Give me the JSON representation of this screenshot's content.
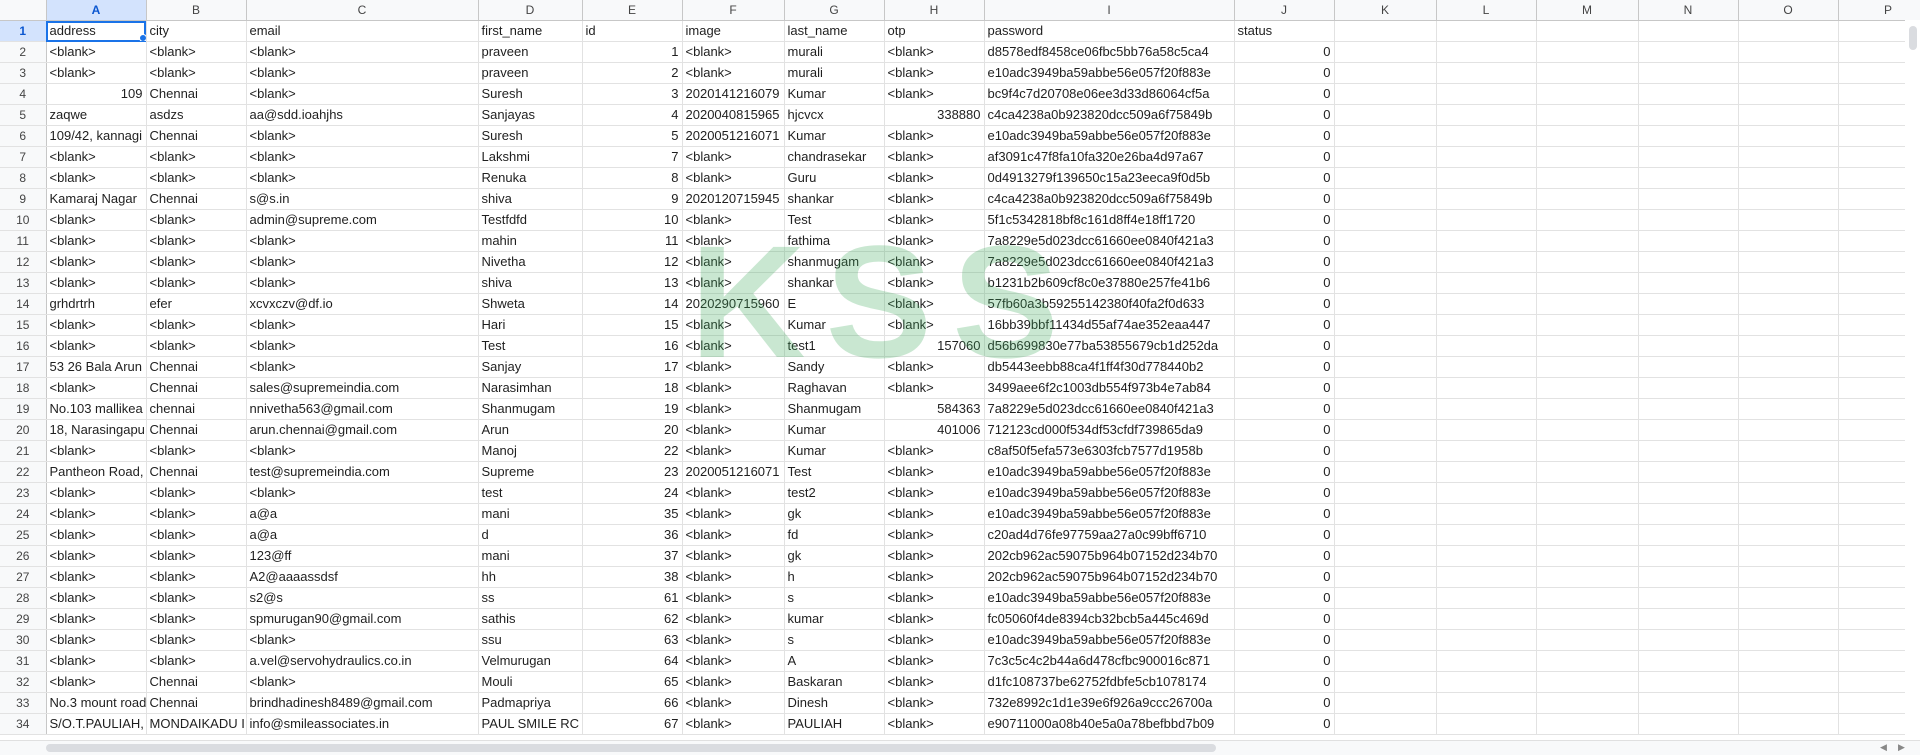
{
  "columns": [
    "A",
    "B",
    "C",
    "D",
    "E",
    "F",
    "G",
    "H",
    "I",
    "J",
    "K",
    "L",
    "M",
    "N",
    "O",
    "P"
  ],
  "header": [
    "address",
    "city",
    "email",
    "first_name",
    "id",
    "image",
    "last_name",
    "otp",
    "password",
    "status",
    "",
    "",
    "",
    "",
    "",
    ""
  ],
  "rows": [
    {
      "n": "2",
      "c": [
        "<blank>",
        "<blank>",
        "<blank>",
        "praveen",
        "1",
        "<blank>",
        "murali",
        "<blank>",
        "d8578edf8458ce06fbc5bb76a58c5ca4",
        "0"
      ]
    },
    {
      "n": "3",
      "c": [
        "<blank>",
        "<blank>",
        "<blank>",
        "praveen",
        "2",
        "<blank>",
        "murali",
        "<blank>",
        "e10adc3949ba59abbe56e057f20f883e",
        "0"
      ]
    },
    {
      "n": "4",
      "c": [
        "109",
        "Chennai",
        "<blank>",
        "Suresh",
        "3",
        "2020141216079",
        "Kumar",
        "<blank>",
        "bc9f4c7d20708e06ee3d33d86064cf5a",
        "0"
      ]
    },
    {
      "n": "5",
      "c": [
        "zaqwe",
        "asdzs",
        "aa@sdd.ioahjhs",
        "Sanjayas",
        "4",
        "2020040815965",
        "hjcvcx",
        "338880",
        "c4ca4238a0b923820dcc509a6f75849b",
        "0"
      ]
    },
    {
      "n": "6",
      "c": [
        "109/42, kannagi",
        "Chennai",
        "<blank>",
        "Suresh",
        "5",
        "2020051216071",
        "Kumar",
        "<blank>",
        "e10adc3949ba59abbe56e057f20f883e",
        "0"
      ]
    },
    {
      "n": "7",
      "c": [
        "<blank>",
        "<blank>",
        "<blank>",
        "Lakshmi",
        "7",
        "<blank>",
        "chandrasekar",
        "<blank>",
        "af3091c47f8fa10fa320e26ba4d97a67",
        "0"
      ]
    },
    {
      "n": "8",
      "c": [
        "<blank>",
        "<blank>",
        "<blank>",
        "Renuka",
        "8",
        "<blank>",
        "Guru",
        "<blank>",
        "0d4913279f139650c15a23eeca9f0d5b",
        "0"
      ]
    },
    {
      "n": "9",
      "c": [
        "Kamaraj Nagar",
        "Chennai",
        "s@s.in",
        "shiva",
        "9",
        "2020120715945",
        "shankar",
        "<blank>",
        "c4ca4238a0b923820dcc509a6f75849b",
        "0"
      ]
    },
    {
      "n": "10",
      "c": [
        "<blank>",
        "<blank>",
        "admin@supreme.com",
        "Testfdfd",
        "10",
        "<blank>",
        "Test",
        "<blank>",
        "5f1c5342818bf8c161d8ff4e18ff1720",
        "0"
      ]
    },
    {
      "n": "11",
      "c": [
        "<blank>",
        "<blank>",
        "<blank>",
        "mahin",
        "11",
        "<blank>",
        "fathima",
        "<blank>",
        "7a8229e5d023dcc61660ee0840f421a3",
        "0"
      ]
    },
    {
      "n": "12",
      "c": [
        "<blank>",
        "<blank>",
        "<blank>",
        "Nivetha",
        "12",
        "<blank>",
        "shanmugam",
        "<blank>",
        "7a8229e5d023dcc61660ee0840f421a3",
        "0"
      ]
    },
    {
      "n": "13",
      "c": [
        "<blank>",
        "<blank>",
        "<blank>",
        "shiva",
        "13",
        "<blank>",
        "shankar",
        "<blank>",
        "b1231b2b609cf8c0e37880e257fe41b6",
        "0"
      ]
    },
    {
      "n": "14",
      "c": [
        "grhdrtrh",
        "efer",
        "xcvxczv@df.io",
        "Shweta",
        "14",
        "2020290715960",
        "E",
        "<blank>",
        "57fb60a3b59255142380f40fa2f0d633",
        "0"
      ]
    },
    {
      "n": "15",
      "c": [
        "<blank>",
        "<blank>",
        "<blank>",
        "Hari",
        "15",
        "<blank>",
        "Kumar",
        "<blank>",
        "16bb39bbf11434d55af74ae352eaa447",
        "0"
      ]
    },
    {
      "n": "16",
      "c": [
        "<blank>",
        "<blank>",
        "<blank>",
        "Test",
        "16",
        "<blank>",
        "test1",
        "157060",
        "d56b699830e77ba53855679cb1d252da",
        "0"
      ]
    },
    {
      "n": "17",
      "c": [
        "53 26 Bala Arun",
        "Chennai",
        "<blank>",
        "Sanjay",
        "17",
        "<blank>",
        "Sandy",
        "<blank>",
        "db5443eebb88ca4f1ff4f30d778440b2",
        "0"
      ]
    },
    {
      "n": "18",
      "c": [
        "<blank>",
        "Chennai",
        "sales@supremeindia.com",
        "Narasimhan",
        "18",
        "<blank>",
        "Raghavan",
        "<blank>",
        "3499aee6f2c1003db554f973b4e7ab84",
        "0"
      ]
    },
    {
      "n": "19",
      "c": [
        "No.103 mallikea",
        "chennai",
        "nnivetha563@gmail.com",
        "Shanmugam",
        "19",
        "<blank>",
        "Shanmugam",
        "584363",
        "7a8229e5d023dcc61660ee0840f421a3",
        "0"
      ]
    },
    {
      "n": "20",
      "c": [
        "18, Narasingapu",
        "Chennai",
        "arun.chennai@gmail.com",
        "Arun",
        "20",
        "<blank>",
        "Kumar",
        "401006",
        "712123cd000f534df53cfdf739865da9",
        "0"
      ]
    },
    {
      "n": "21",
      "c": [
        "<blank>",
        "<blank>",
        "<blank>",
        "Manoj",
        "22",
        "<blank>",
        "Kumar",
        "<blank>",
        "c8af50f5efa573e6303fcb7577d1958b",
        "0"
      ]
    },
    {
      "n": "22",
      "c": [
        "Pantheon Road,",
        "Chennai",
        "test@supremeindia.com",
        "Supreme",
        "23",
        "2020051216071",
        "Test",
        "<blank>",
        "e10adc3949ba59abbe56e057f20f883e",
        "0"
      ]
    },
    {
      "n": "23",
      "c": [
        "<blank>",
        "<blank>",
        "<blank>",
        "test",
        "24",
        "<blank>",
        "test2",
        "<blank>",
        "e10adc3949ba59abbe56e057f20f883e",
        "0"
      ]
    },
    {
      "n": "24",
      "c": [
        "<blank>",
        "<blank>",
        "a@a",
        "mani",
        "35",
        "<blank>",
        "gk",
        "<blank>",
        "e10adc3949ba59abbe56e057f20f883e",
        "0"
      ]
    },
    {
      "n": "25",
      "c": [
        "<blank>",
        "<blank>",
        "a@a",
        "d",
        "36",
        "<blank>",
        "fd",
        "<blank>",
        "c20ad4d76fe97759aa27a0c99bff6710",
        "0"
      ]
    },
    {
      "n": "26",
      "c": [
        "<blank>",
        "<blank>",
        "123@ff",
        "mani",
        "37",
        "<blank>",
        "gk",
        "<blank>",
        "202cb962ac59075b964b07152d234b70",
        "0"
      ]
    },
    {
      "n": "27",
      "c": [
        "<blank>",
        "<blank>",
        "A2@aaaassdsf",
        "hh",
        "38",
        "<blank>",
        "h",
        "<blank>",
        "202cb962ac59075b964b07152d234b70",
        "0"
      ]
    },
    {
      "n": "28",
      "c": [
        "<blank>",
        "<blank>",
        "s2@s",
        "ss",
        "61",
        "<blank>",
        "s",
        "<blank>",
        "e10adc3949ba59abbe56e057f20f883e",
        "0"
      ]
    },
    {
      "n": "29",
      "c": [
        "<blank>",
        "<blank>",
        "spmurugan90@gmail.com",
        "sathis",
        "62",
        "<blank>",
        "kumar",
        "<blank>",
        "fc05060f4de8394cb32bcb5a445c469d",
        "0"
      ]
    },
    {
      "n": "30",
      "c": [
        "<blank>",
        "<blank>",
        "<blank>",
        "ssu",
        "63",
        "<blank>",
        "s",
        "<blank>",
        "e10adc3949ba59abbe56e057f20f883e",
        "0"
      ]
    },
    {
      "n": "31",
      "c": [
        "<blank>",
        "<blank>",
        "a.vel@servohydraulics.co.in",
        "Velmurugan",
        "64",
        "<blank>",
        "A",
        "<blank>",
        "7c3c5c4c2b44a6d478cfbc900016c871",
        "0"
      ]
    },
    {
      "n": "32",
      "c": [
        "<blank>",
        "Chennai",
        "<blank>",
        "Mouli",
        "65",
        "<blank>",
        "Baskaran",
        "<blank>",
        "d1fc108737be62752fdbfe5cb1078174",
        "0"
      ]
    },
    {
      "n": "33",
      "c": [
        "No.3 mount road",
        "Chennai",
        "brindhadinesh8489@gmail.com",
        "Padmapriya",
        "66",
        "<blank>",
        "Dinesh",
        "<blank>",
        "732e8992c1d1e39e6f926a9ccc26700a",
        "0"
      ]
    },
    {
      "n": "34",
      "c": [
        "S/O.T.PAULIAH,",
        "MONDAIKADU I",
        "info@smileassociates.in",
        "PAUL SMILE RC",
        "67",
        "<blank>",
        "PAULIAH",
        "<blank>",
        "e90711000a08b40e5a0a78befbbd7b09",
        "0"
      ]
    }
  ],
  "watermark": "KSS",
  "colors": {
    "accent": "#1a73e8",
    "header_bg": "#f8f9fa",
    "selected_header": "#d3e3fd",
    "watermark": "#3caa5a"
  }
}
